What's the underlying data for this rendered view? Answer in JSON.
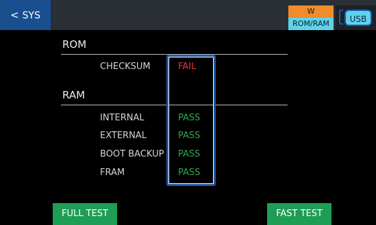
{
  "header": {
    "back_label": "SYS",
    "mode_top": "W",
    "mode_bottom": "ROM/RAM",
    "usb_label": "USB"
  },
  "rom": {
    "title": "ROM",
    "rows": [
      {
        "label": "CHECKSUM",
        "status": "FAIL"
      }
    ]
  },
  "ram": {
    "title": "RAM",
    "rows": [
      {
        "label": "INTERNAL",
        "status": "PASS"
      },
      {
        "label": "EXTERNAL",
        "status": "PASS"
      },
      {
        "label": "BOOT BACKUP",
        "status": "PASS"
      },
      {
        "label": "FRAM",
        "status": "PASS"
      }
    ]
  },
  "actions": {
    "full_test": "FULL TEST",
    "fast_test": "FAST TEST"
  },
  "colors": {
    "pass": "#2fa84f",
    "fail": "#e23b3b",
    "accent_blue": "#1a4f8f",
    "button_green": "#1e9d55",
    "mode_orange": "#f28a2e",
    "mode_cyan": "#5ed3ea"
  }
}
